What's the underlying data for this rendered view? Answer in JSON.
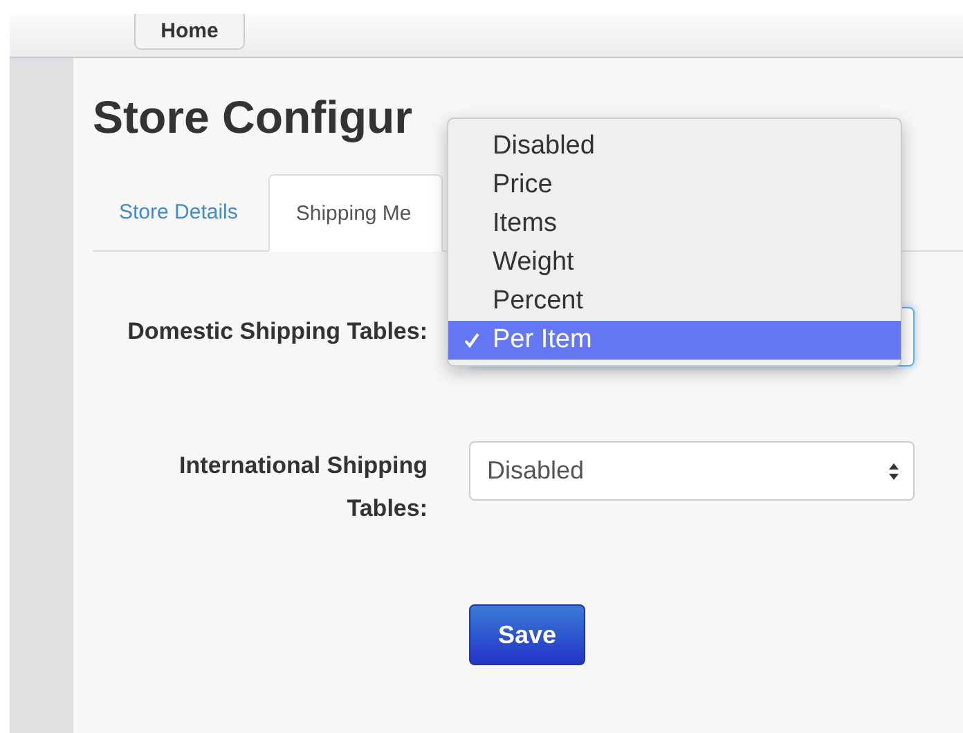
{
  "nav": {
    "home": "Home"
  },
  "title": "Store Configur",
  "tabs": [
    {
      "label": "Store Details",
      "selected": false
    },
    {
      "label": "Shipping Me",
      "selected": true
    }
  ],
  "fields": [
    {
      "label": "Domestic Shipping Tables:",
      "open": true,
      "options": [
        {
          "label": "Disabled",
          "selected": false
        },
        {
          "label": "Price",
          "selected": false
        },
        {
          "label": "Items",
          "selected": false
        },
        {
          "label": "Weight",
          "selected": false
        },
        {
          "label": "Percent",
          "selected": false
        },
        {
          "label": "Per Item",
          "selected": true
        }
      ]
    },
    {
      "label": "International Shipping Tables:",
      "open": false,
      "value": "Disabled"
    }
  ],
  "save": "Save"
}
